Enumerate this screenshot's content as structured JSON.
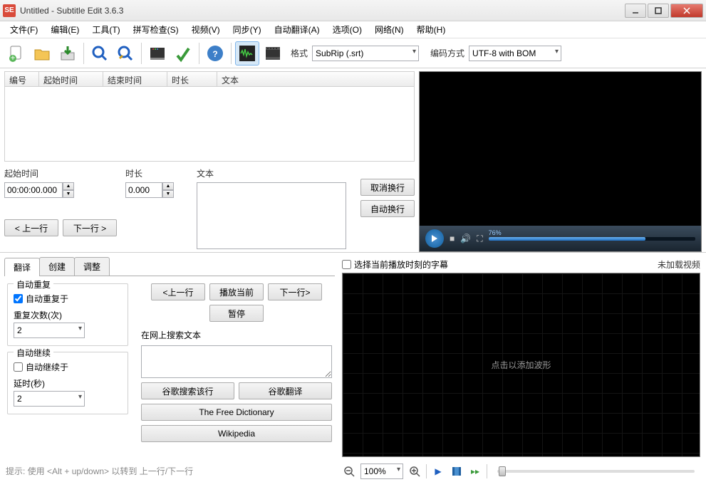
{
  "title": "Untitled - Subtitle Edit 3.6.3",
  "app_icon_text": "SE",
  "menu": [
    "文件(F)",
    "编辑(E)",
    "工具(T)",
    "拼写检查(S)",
    "视频(V)",
    "同步(Y)",
    "自动翻译(A)",
    "选项(O)",
    "网络(N)",
    "帮助(H)"
  ],
  "toolbar": {
    "format_label": "格式",
    "format_value": "SubRip (.srt)",
    "encoding_label": "编码方式",
    "encoding_value": "UTF-8 with BOM"
  },
  "grid": {
    "columns": [
      "编号",
      "起始时间",
      "结束时间",
      "时长",
      "文本"
    ]
  },
  "edit": {
    "start_label": "起始时间",
    "start_value": "00:00:00.000",
    "duration_label": "时长",
    "duration_value": "0.000",
    "text_label": "文本",
    "unbreak_btn": "取消换行",
    "autobreak_btn": "自动换行",
    "prev_btn": "< 上一行",
    "next_btn": "下一行 >"
  },
  "video": {
    "progress_label": "76%"
  },
  "tabs": [
    "翻译",
    "创建",
    "调整"
  ],
  "translate": {
    "auto_repeat_title": "自动重复",
    "auto_repeat_on": "自动重复于",
    "repeat_count_label": "重复次数(次)",
    "repeat_count_value": "2",
    "auto_continue_title": "自动继续",
    "auto_continue_on": "自动继续于",
    "delay_label": "延时(秒)",
    "delay_value": "2",
    "prev": "<上一行",
    "play_current": "播放当前",
    "next": "下一行>",
    "pause": "暂停",
    "search_label": "在网上搜索文本",
    "google_search": "谷歌搜索该行",
    "google_translate": "谷歌翻译",
    "free_dict": "The Free Dictionary",
    "wikipedia": "Wikipedia"
  },
  "hint": "提示: 使用 <Alt + up/down> 以转到 上一行/下一行",
  "bottom_right": {
    "select_subtitle": "选择当前播放时刻的字幕",
    "no_video": "未加载视频",
    "waveform_hint": "点击以添加波形",
    "zoom_value": "100%"
  }
}
